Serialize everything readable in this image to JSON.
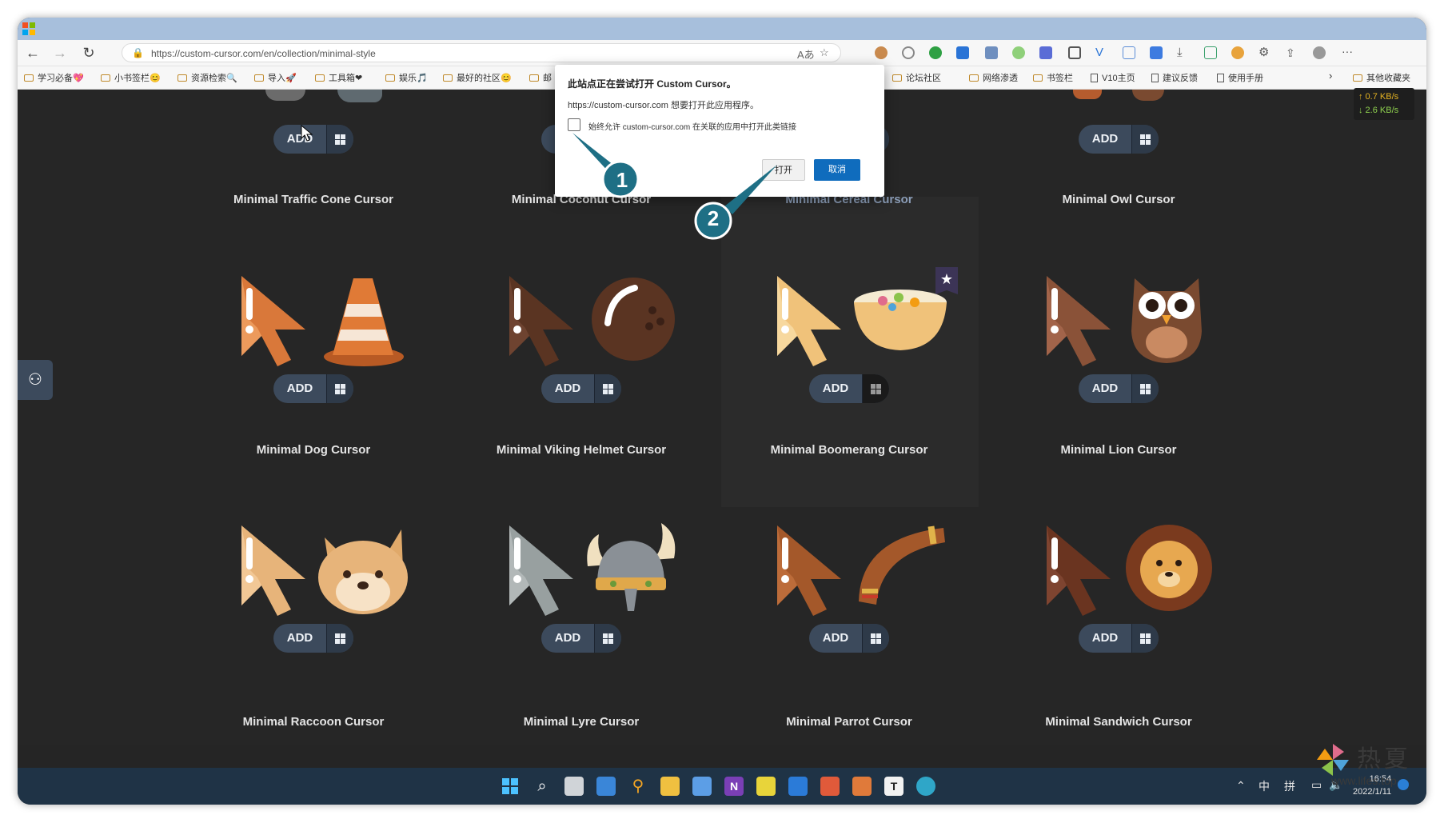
{
  "browser": {
    "url": "https://custom-cursor.com/en/collection/minimal-style",
    "bookmarks": [
      "学习必备💖",
      "小书签栏😊",
      "资源检索🔍",
      "导入🚀",
      "工具箱❤",
      "娱乐🎵",
      "最好的社区😊",
      "邮",
      "论坛社区",
      "网络渗透",
      "书签栏",
      "V10主页",
      "建议反馈",
      "使用手册",
      "其他收藏夹"
    ],
    "net_up": "↑ 0.7 KB/s",
    "net_down": "↓ 2.6 KB/s"
  },
  "dialog": {
    "title": "此站点正在尝试打开 Custom Cursor。",
    "message": "https://custom-cursor.com 想要打开此应用程序。",
    "checkbox_label": "始终允许 custom-cursor.com 在关联的应用中打开此类链接",
    "open_label": "打开",
    "cancel_label": "取消"
  },
  "callouts": {
    "one": "1",
    "two": "2"
  },
  "grid": {
    "add_label": "ADD",
    "row1_names": [
      "Minimal Traffic Cone Cursor",
      "Minimal Coconut Cursor",
      "Minimal Cereal Cursor",
      "Minimal Owl Cursor"
    ],
    "row2_names": [
      "Minimal Dog Cursor",
      "Minimal Viking Helmet Cursor",
      "Minimal Boomerang Cursor",
      "Minimal Lion Cursor"
    ],
    "row3_names": [
      "Minimal Raccoon Cursor",
      "Minimal Lyre Cursor",
      "Minimal Parrot Cursor",
      "Minimal Sandwich Cursor"
    ]
  },
  "taskbar": {
    "ime1": "中",
    "ime2": "拼",
    "time": "16:54",
    "date": "2022/1/11"
  },
  "watermark": {
    "title": "热夏",
    "url": "www.lifes.top"
  },
  "colors": {
    "page_bg": "#262626",
    "button": "#3c4a5c",
    "dialog_primary": "#0f6cbd",
    "callout": "#1e6f85",
    "taskbar": "#1f3346"
  }
}
